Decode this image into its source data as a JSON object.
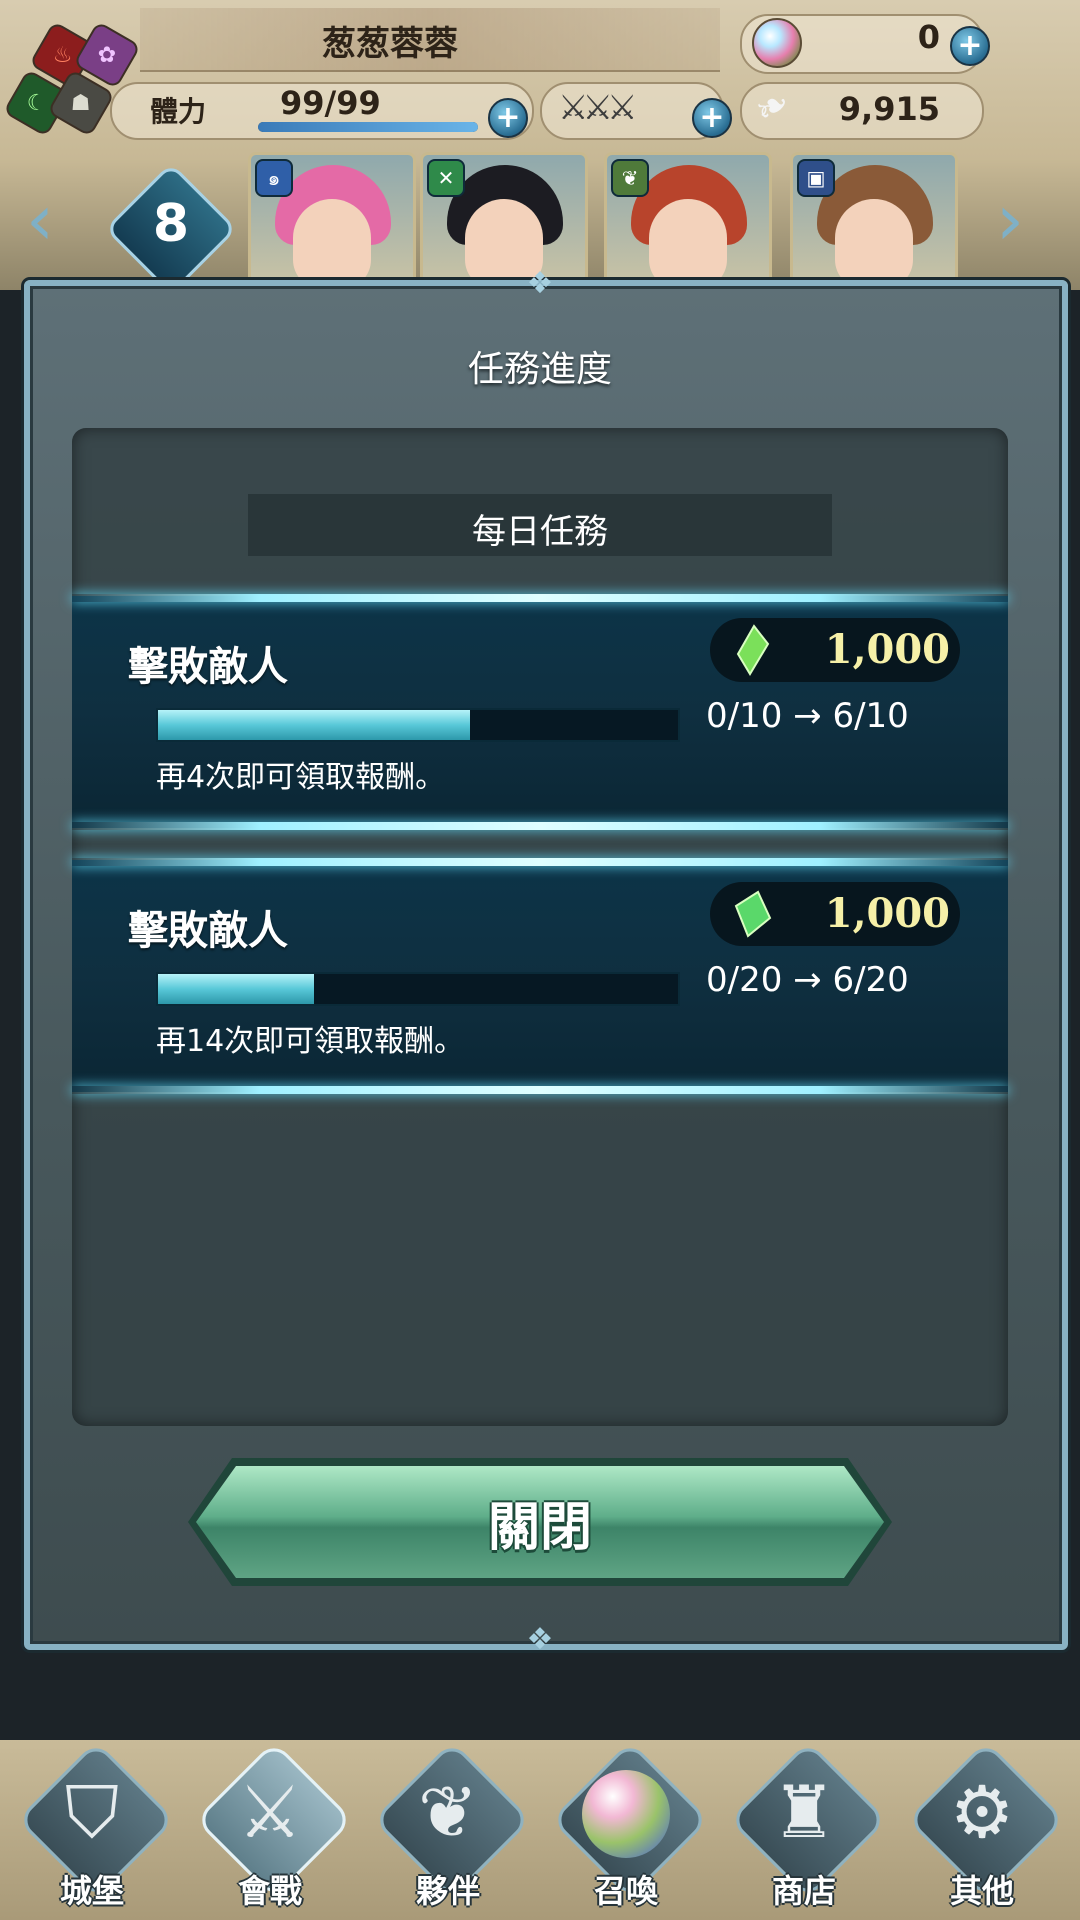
{
  "hud": {
    "player_name": "葱葱蓉蓉",
    "orbs": "0",
    "stamina_label": "體力",
    "stamina_value": "99/99",
    "stamina_fraction": 1.0,
    "feathers": "9,915",
    "plus": "+",
    "level": "8",
    "elements": [
      "fire-icon",
      "light-icon",
      "wind-icon",
      "earth-icon"
    ],
    "heroes": [
      {
        "badge_icon": "water-icon",
        "badge_color": "#2f5fa8",
        "hair": "#e46aa6"
      },
      {
        "badge_icon": "bow-icon",
        "badge_color": "#2f8a4a",
        "hair": "#1c1c22"
      },
      {
        "badge_icon": "leaf-icon",
        "badge_color": "#4f7a3a",
        "hair": "#b8442c"
      },
      {
        "badge_icon": "tome-icon",
        "badge_color": "#2f4f8a",
        "hair": "#8a5a38"
      }
    ]
  },
  "dialog": {
    "title": "任務進度",
    "section_title": "每日任務",
    "quests": [
      {
        "name": "擊敗敵人",
        "reward_icon": "crystal-shard-icon",
        "reward_color": "#7be05a",
        "reward": "1,000",
        "progress": 0.6,
        "progress_text": "0/10 → 6/10",
        "remaining_text": "再4次即可領取報酬。"
      },
      {
        "name": "擊敗敵人",
        "reward_icon": "crystal-icon",
        "reward_color": "#5ad86a",
        "reward": "1,000",
        "progress": 0.3,
        "progress_text": "0/20 → 6/20",
        "remaining_text": "再14次即可領取報酬。"
      }
    ],
    "close_label": "關閉"
  },
  "nav": [
    {
      "label": "城堡",
      "icon": "castle-crest-icon",
      "glyph": "⛉",
      "active": false
    },
    {
      "label": "會戰",
      "icon": "crossed-swords-icon",
      "glyph": "⚔",
      "active": true
    },
    {
      "label": "夥伴",
      "icon": "wing-icon",
      "glyph": "❦",
      "active": false
    },
    {
      "label": "召喚",
      "icon": "summon-orb-icon",
      "glyph": "",
      "active": false
    },
    {
      "label": "商店",
      "icon": "shop-tower-icon",
      "glyph": "♜",
      "active": false
    },
    {
      "label": "其他",
      "icon": "gear-icon",
      "glyph": "⚙",
      "active": false
    }
  ],
  "colors": {
    "accent": "#88b2c4",
    "reward_text": "#f6f0a8",
    "progress": "#58c8d8",
    "close_button": "#5fae8a"
  }
}
